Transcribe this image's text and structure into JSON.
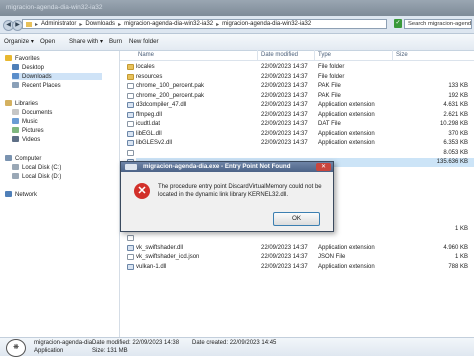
{
  "window": {
    "title": "migracion-agenda-dia-win32-ia32"
  },
  "address": {
    "crumbs": [
      "Administrator",
      "Downloads",
      "migracion-agenda-dia-win32-ia32",
      "migracion-agenda-dia-win32-ia32"
    ],
    "search_placeholder": "Search migracion-agend..."
  },
  "toolbar": {
    "organize": "Organize ▾",
    "open": "Open",
    "share": "Share with ▾",
    "burn": "Burn",
    "new_folder": "New folder"
  },
  "nav": {
    "favorites": "Favorites",
    "desktop": "Desktop",
    "downloads": "Downloads",
    "recent": "Recent Places",
    "libraries": "Libraries",
    "documents": "Documents",
    "music": "Music",
    "pictures": "Pictures",
    "videos": "Videos",
    "computer": "Computer",
    "local_c": "Local Disk (C:)",
    "local_d": "Local Disk (D:)",
    "network": "Network"
  },
  "columns": {
    "name": "Name",
    "date": "Date modified",
    "type": "Type",
    "size": "Size"
  },
  "files": [
    {
      "name": "locales",
      "date": "22/09/2023 14:37",
      "type": "File folder",
      "size": "",
      "kind": "folder"
    },
    {
      "name": "resources",
      "date": "22/09/2023 14:37",
      "type": "File folder",
      "size": "",
      "kind": "folder"
    },
    {
      "name": "chrome_100_percent.pak",
      "date": "22/09/2023 14:37",
      "type": "PAK File",
      "size": "133 KB",
      "kind": "file"
    },
    {
      "name": "chrome_200_percent.pak",
      "date": "22/09/2023 14:37",
      "type": "PAK File",
      "size": "192 KB",
      "kind": "file"
    },
    {
      "name": "d3dcompiler_47.dll",
      "date": "22/09/2023 14:37",
      "type": "Application extension",
      "size": "4.631 KB",
      "kind": "app"
    },
    {
      "name": "ffmpeg.dll",
      "date": "22/09/2023 14:37",
      "type": "Application extension",
      "size": "2.621 KB",
      "kind": "app"
    },
    {
      "name": "icudtl.dat",
      "date": "22/09/2023 14:37",
      "type": "DAT File",
      "size": "10.298 KB",
      "kind": "file"
    },
    {
      "name": "libEGL.dll",
      "date": "22/09/2023 14:37",
      "type": "Application extension",
      "size": "370 KB",
      "kind": "app"
    },
    {
      "name": "libGLESv2.dll",
      "date": "22/09/2023 14:37",
      "type": "Application extension",
      "size": "6.353 KB",
      "kind": "app"
    },
    {
      "name": "",
      "date": "",
      "type": "",
      "size": "8.053 KB",
      "kind": "file"
    },
    {
      "name": "",
      "date": "",
      "type": "",
      "size": "135.636 KB",
      "kind": "app"
    },
    {
      "name": "",
      "date": "",
      "type": "",
      "size": "",
      "kind": "file"
    },
    {
      "name": "",
      "date": "",
      "type": "",
      "size": "",
      "kind": "file"
    },
    {
      "name": "",
      "date": "",
      "type": "",
      "size": "",
      "kind": "file"
    },
    {
      "name": "",
      "date": "",
      "type": "",
      "size": "",
      "kind": "file"
    },
    {
      "name": "",
      "date": "",
      "type": "",
      "size": "",
      "kind": "file"
    },
    {
      "name": "",
      "date": "",
      "type": "",
      "size": "",
      "kind": "file"
    },
    {
      "name": "",
      "date": "",
      "type": "",
      "size": "1 KB",
      "kind": "file"
    },
    {
      "name": "",
      "date": "",
      "type": "",
      "size": "",
      "kind": "file"
    },
    {
      "name": "vk_swiftshader.dll",
      "date": "22/09/2023 14:37",
      "type": "Application extension",
      "size": "4.960 KB",
      "kind": "app"
    },
    {
      "name": "vk_swiftshader_icd.json",
      "date": "22/09/2023 14:37",
      "type": "JSON File",
      "size": "1 KB",
      "kind": "file"
    },
    {
      "name": "vulkan-1.dll",
      "date": "22/09/2023 14:37",
      "type": "Application extension",
      "size": "788 KB",
      "kind": "app"
    }
  ],
  "dialog": {
    "title": "migracion-agenda-dia.exe - Entry Point Not Found",
    "message": "The procedure entry point DiscardVirtualMemory could not be located in the dynamic link library KERNEL32.dll.",
    "ok": "OK"
  },
  "details": {
    "name": "migracion-agenda-dia",
    "modified": "Date modified: 22/09/2023 14:38",
    "created": "Date created: 22/09/2023 14:45",
    "type": "Application",
    "size": "Size: 131 MB"
  }
}
